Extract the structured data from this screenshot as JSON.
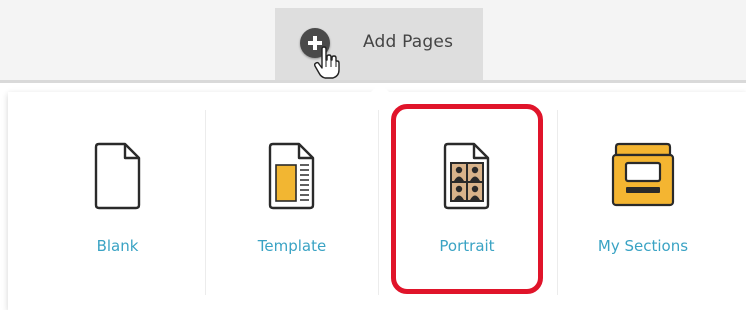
{
  "toolbar": {
    "add_pages_label": "Add Pages",
    "add_icon": "plus-circle-icon",
    "cursor_icon": "hand-pointer-icon"
  },
  "page_options": [
    {
      "label": "Blank",
      "icon": "blank-page-icon"
    },
    {
      "label": "Template",
      "icon": "template-page-icon"
    },
    {
      "label": "Portrait",
      "icon": "portrait-page-icon",
      "highlighted": true
    },
    {
      "label": "My Sections",
      "icon": "my-sections-folder-icon"
    }
  ],
  "colors": {
    "label_text": "#3aa3c4",
    "highlight": "#e0142a",
    "template_accent": "#f2b632",
    "folder_body": "#f4b531"
  }
}
